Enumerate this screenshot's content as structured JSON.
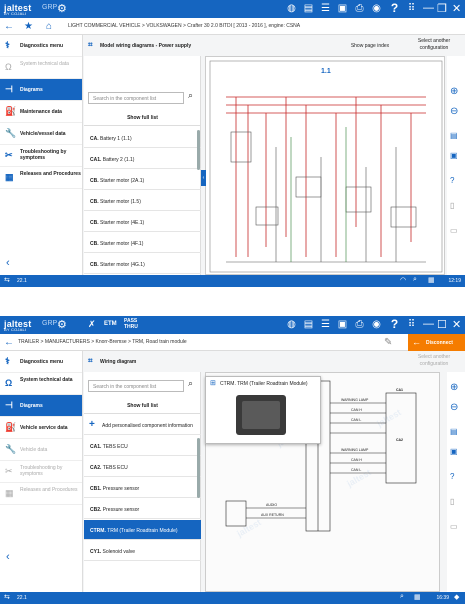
{
  "shot1": {
    "logo": "jaltest",
    "logo_sub": "BY COJALI",
    "group": "GRP",
    "breadcrumb": "LIGHT COMMERCIAL VEHICLE  >  VOLKSWAGEN  >  Crafter 30 2.0 BITDI [ 2013 - 2016 ], engine: CSNA",
    "sidebar": [
      {
        "label": "Diagnostics menu",
        "icon": "stethoscope-icon",
        "state": "normal"
      },
      {
        "label": "System technical data",
        "icon": "headset-icon",
        "state": "disabled"
      },
      {
        "label": "Diagrams",
        "icon": "diagram-icon",
        "state": "active"
      },
      {
        "label": "Maintenance data",
        "icon": "oil-can-icon",
        "state": "normal"
      },
      {
        "label": "Vehicle/vessel data",
        "icon": "wrench-icon",
        "state": "normal"
      },
      {
        "label": "Troubleshooting by symptoms",
        "icon": "tools-icon",
        "state": "normal"
      },
      {
        "label": "Releases and Procedures",
        "icon": "document-icon",
        "state": "normal"
      }
    ],
    "panel_title": "Model wiring diagrams - Power supply",
    "search_placeholder": "Search in the component list",
    "full_list": "Show full list",
    "components": [
      {
        "code": "CA.",
        "name": "Battery 1 (1.1)"
      },
      {
        "code": "CA1.",
        "name": "Battery 2 (1.1)"
      },
      {
        "code": "CB.",
        "name": "Starter motor (2A.1)"
      },
      {
        "code": "CB.",
        "name": "Starter motor (1.5)"
      },
      {
        "code": "CB.",
        "name": "Starter motor (4E.1)"
      },
      {
        "code": "CB.",
        "name": "Starter motor (4F.1)"
      },
      {
        "code": "CB.",
        "name": "Starter motor (4G.1)"
      }
    ],
    "show_page_index": "Show page index",
    "select_config": "Select another configuration",
    "diagram_page": "1.1",
    "version": "22.1",
    "clock": "12:19"
  },
  "shot2": {
    "logo": "jaltest",
    "logo_sub": "BY COJALI",
    "group": "GRP",
    "etm": "ETM",
    "pass_thru": "PASS THRU",
    "breadcrumb": "TRAILER  >  MANUFACTURERS  >  Knorr-Bremse  >  TRM, Road train module",
    "disconnect": "Disconnect",
    "select_config": "Select another configuration",
    "sidebar": [
      {
        "label": "Diagnostics menu",
        "icon": "stethoscope-icon",
        "state": "normal"
      },
      {
        "label": "System technical data",
        "icon": "headset-icon",
        "state": "normal"
      },
      {
        "label": "Diagrams",
        "icon": "diagram-icon",
        "state": "active"
      },
      {
        "label": "Vehicle service data",
        "icon": "oil-can-icon",
        "state": "normal"
      },
      {
        "label": "Vehicle data",
        "icon": "wrench-icon",
        "state": "disabled"
      },
      {
        "label": "Troubleshooting by symptoms",
        "icon": "tools-icon",
        "state": "disabled"
      },
      {
        "label": "Releases and Procedures",
        "icon": "document-icon",
        "state": "disabled"
      }
    ],
    "panel_title": "Wiring diagram",
    "search_placeholder": "Search in the component list",
    "full_list": "Show full list",
    "add_component": "Add personalised component information",
    "components": [
      {
        "code": "CA1.",
        "name": "TEBS ECU",
        "selected": false
      },
      {
        "code": "CA2.",
        "name": "TEBS ECU",
        "selected": false
      },
      {
        "code": "CB1.",
        "name": "Pressure sensor",
        "selected": false
      },
      {
        "code": "CB2.",
        "name": "Pressure sensor",
        "selected": false
      },
      {
        "code": "CTRM.",
        "name": "TRM (Trailer Roadtrain Module)",
        "selected": true
      },
      {
        "code": "CY1.",
        "name": "Solenoid valve",
        "selected": false
      }
    ],
    "popup_title": "CTRM. TRM (Trailer Roadtrain Module)",
    "diagram_labels": {
      "warning_lamp": "WARNING LAMP",
      "can_h": "CAN H",
      "can_l": "CAN L",
      "audio": "AUDIO",
      "aux_return": "AUX RETURN",
      "can_header": "CA1",
      "ca2_header": "CA2"
    },
    "version": "22.1",
    "clock": "16:39"
  }
}
